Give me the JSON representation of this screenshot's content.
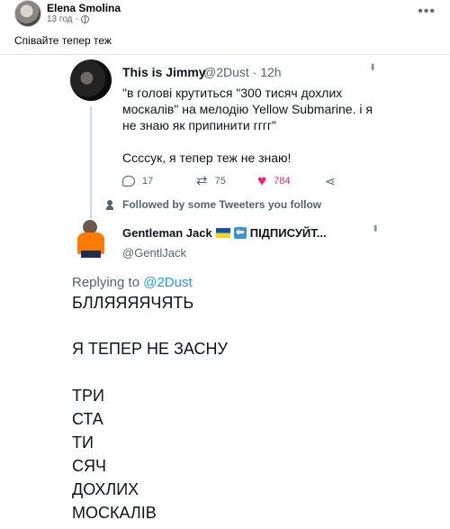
{
  "post": {
    "author": "Elena Smolina",
    "time": "13 год",
    "separator": "·",
    "text": "Співайте тепер теж",
    "more": "•••"
  },
  "tweet": {
    "name": "This is Jimmy",
    "handle": "@2Dust · 12h",
    "body_line1": "\"в голові крутиться \"300 тисяч дохлих москалів\" на мелодію Yellow Submarine. і я не знаю як припинити гггг\"",
    "body_line2": "Ссссук, я тепер теж не знаю!",
    "replies": "17",
    "retweets": "75",
    "likes": "784"
  },
  "followed_text": "Followed by some Tweeters you follow",
  "reply": {
    "name": "Gentleman Jack",
    "name_suffix": "ПІДПИСУЙТ...",
    "handle": "@GentlJack",
    "replying_prefix": "Replying to ",
    "replying_to": "@2Dust",
    "lines": [
      "БЛЛЯЯЯЯЧЯТЬ",
      "Я ТЕПЕР НЕ ЗАСНУ",
      "ТРИ",
      "СТА",
      "ТИ",
      "СЯЧ",
      "ДОХЛИХ",
      "МОСКАЛІВ"
    ]
  },
  "icons": [
    "globe-icon",
    "reply-icon",
    "retweet-icon",
    "heart-icon",
    "share-icon",
    "person-icon",
    "ukraine-flag-icon",
    "arrow-left-icon"
  ],
  "colors": {
    "like": "#f91880",
    "mention": "#1d9bf0",
    "muted": "#536471"
  }
}
